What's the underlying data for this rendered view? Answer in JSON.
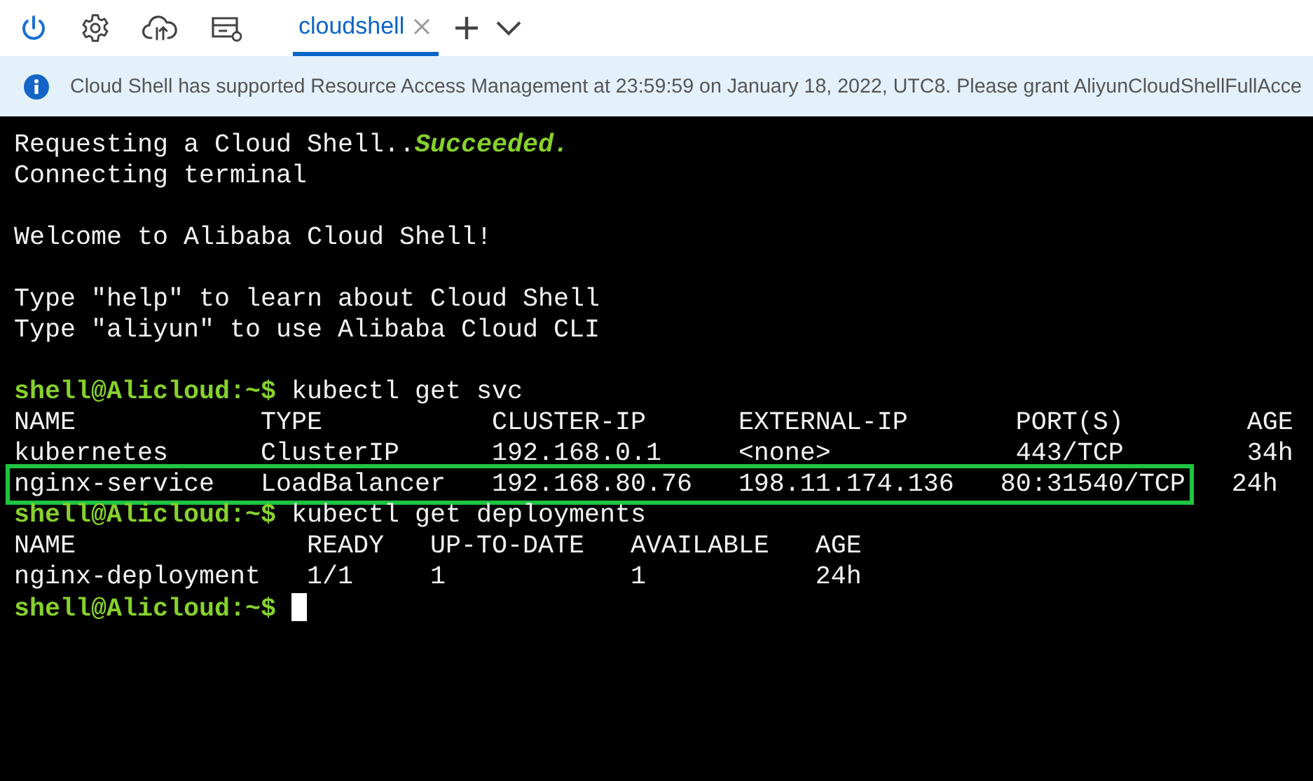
{
  "toolbar": {
    "tabs": [
      {
        "label": "cloudshell",
        "selected": true,
        "closable": true
      }
    ]
  },
  "banner": {
    "message": "Cloud Shell has supported Resource Access Management at 23:59:59 on January 18, 2022, UTC8. Please grant AliyunCloudShellFullAcce"
  },
  "terminal": {
    "lines": [
      {
        "kind": "output",
        "segments": [
          {
            "text": "Requesting a Cloud Shell..",
            "kind": "plain"
          },
          {
            "text": "Succeeded.",
            "kind": "success"
          }
        ]
      },
      {
        "kind": "output",
        "segments": [
          {
            "text": "Connecting terminal",
            "kind": "plain"
          }
        ]
      },
      {
        "kind": "blank"
      },
      {
        "kind": "output",
        "segments": [
          {
            "text": "Welcome to Alibaba Cloud Shell!",
            "kind": "plain"
          }
        ]
      },
      {
        "kind": "blank"
      },
      {
        "kind": "output",
        "segments": [
          {
            "text": "Type \"help\" to learn about Cloud Shell",
            "kind": "plain"
          }
        ]
      },
      {
        "kind": "output",
        "segments": [
          {
            "text": "Type \"aliyun\" to use Alibaba Cloud CLI",
            "kind": "plain"
          }
        ]
      },
      {
        "kind": "blank"
      },
      {
        "kind": "output",
        "segments": [
          {
            "text": "shell@Alicloud:~$",
            "kind": "prompt"
          },
          {
            "text": " kubectl get svc",
            "kind": "plain"
          }
        ]
      },
      {
        "kind": "output",
        "segments": [
          {
            "text": "NAME            TYPE           CLUSTER-IP      EXTERNAL-IP       PORT(S)        AGE",
            "kind": "plain"
          }
        ]
      },
      {
        "kind": "output",
        "segments": [
          {
            "text": "kubernetes      ClusterIP      192.168.0.1     <none>            443/TCP        34h",
            "kind": "plain"
          }
        ]
      },
      {
        "kind": "output",
        "segments": [
          {
            "text": "nginx-service   LoadBalancer   192.168.80.76   198.11.174.136   80:31540/TCP",
            "kind": "plain",
            "highlighted": true
          },
          {
            "text": "   24h",
            "kind": "plain"
          }
        ]
      },
      {
        "kind": "output",
        "segments": [
          {
            "text": "shell@Alicloud:~$",
            "kind": "prompt"
          },
          {
            "text": " kubectl get deployments",
            "kind": "plain"
          }
        ]
      },
      {
        "kind": "output",
        "segments": [
          {
            "text": "NAME               READY   UP-TO-DATE   AVAILABLE   AGE",
            "kind": "plain"
          }
        ]
      },
      {
        "kind": "output",
        "segments": [
          {
            "text": "nginx-deployment   1/1     1            1           24h",
            "kind": "plain"
          }
        ]
      },
      {
        "kind": "output",
        "cursor": true,
        "segments": [
          {
            "text": "shell@Alicloud:~$",
            "kind": "prompt"
          }
        ]
      }
    ]
  }
}
